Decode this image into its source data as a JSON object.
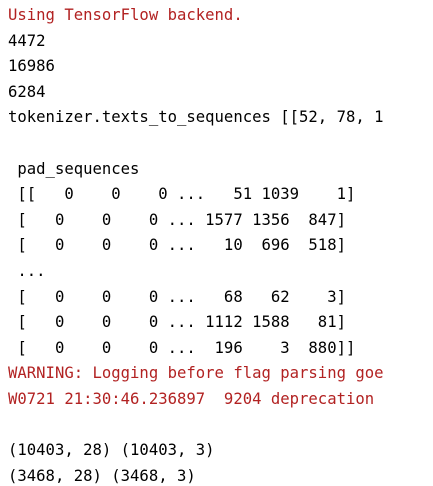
{
  "console": {
    "lines": [
      {
        "text": "Using TensorFlow backend.",
        "stream": "stderr"
      },
      {
        "text": "4472",
        "stream": "stdout"
      },
      {
        "text": "16986",
        "stream": "stdout"
      },
      {
        "text": "6284",
        "stream": "stdout"
      },
      {
        "text": "tokenizer.texts_to_sequences [[52, 78, 1",
        "stream": "stdout"
      },
      {
        "text": "",
        "stream": "stdout"
      },
      {
        "text": " pad_sequences",
        "stream": "stdout"
      },
      {
        "text": " [[   0    0    0 ...   51 1039    1]",
        "stream": "stdout"
      },
      {
        "text": " [   0    0    0 ... 1577 1356  847]",
        "stream": "stdout"
      },
      {
        "text": " [   0    0    0 ...   10  696  518]",
        "stream": "stdout"
      },
      {
        "text": " ...",
        "stream": "stdout"
      },
      {
        "text": " [   0    0    0 ...   68   62    3]",
        "stream": "stdout"
      },
      {
        "text": " [   0    0    0 ... 1112 1588   81]",
        "stream": "stdout"
      },
      {
        "text": " [   0    0    0 ...  196    3  880]]",
        "stream": "stdout"
      },
      {
        "text": "WARNING: Logging before flag parsing goe",
        "stream": "stderr"
      },
      {
        "text": "W0721 21:30:46.236897  9204 deprecation",
        "stream": "stderr"
      },
      {
        "text": "",
        "stream": "stdout"
      },
      {
        "text": "(10403, 28) (10403, 3)",
        "stream": "stdout"
      },
      {
        "text": "(3468, 28) (3468, 3)",
        "stream": "stdout"
      }
    ],
    "colors": {
      "background": "#ffffff",
      "stdout": "#000000",
      "stderr": "#b22222"
    }
  }
}
